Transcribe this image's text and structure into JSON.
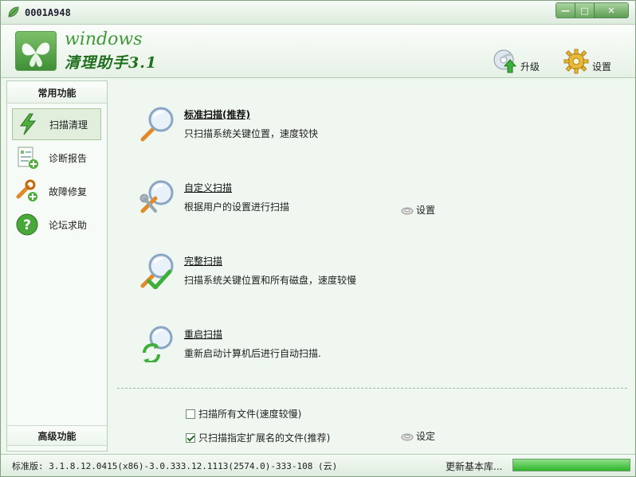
{
  "window": {
    "title": "0001A948",
    "buttons": {
      "minimize": "—",
      "maximize": "□",
      "close": "✕"
    }
  },
  "header": {
    "brand_line1": "windows",
    "brand_line2": "清理助手3.1",
    "upgrade_label": "升级",
    "settings_label": "设置"
  },
  "sidebar": {
    "common_title": "常用功能",
    "items": [
      {
        "label": "扫描清理",
        "icon": "lightning-icon",
        "active": true
      },
      {
        "label": "诊断报告",
        "icon": "report-icon"
      },
      {
        "label": "故障修复",
        "icon": "repair-tools-icon"
      },
      {
        "label": "论坛求助",
        "icon": "help-question-icon"
      }
    ],
    "advanced_title": "高级功能"
  },
  "main": {
    "scans": [
      {
        "title": "标准扫描(推荐)",
        "desc": "只扫描系统关键位置，速度较快",
        "icon": "magnifier-icon"
      },
      {
        "title": "自定义扫描",
        "desc": "根据用户的设置进行扫描",
        "icon": "magnifier-tools-icon",
        "settings_link": "设置"
      },
      {
        "title": "完整扫描",
        "desc": "扫描系统关键位置和所有磁盘，速度较慢",
        "icon": "magnifier-check-icon"
      },
      {
        "title": "重启扫描",
        "desc": "重新启动计算机后进行自动扫描.",
        "icon": "magnifier-restart-icon"
      }
    ],
    "options": [
      {
        "label": "扫描所有文件(速度较慢)",
        "checked": false
      },
      {
        "label": "只扫描指定扩展名的文件(推荐)",
        "checked": true,
        "settings_link": "设定"
      }
    ]
  },
  "status": {
    "version_text": "标准版: 3.1.8.12.0415(x86)-3.0.333.12.1113(2574.0)-333-108 (云)",
    "update_label": "更新基本库...",
    "progress": 1.0
  }
}
